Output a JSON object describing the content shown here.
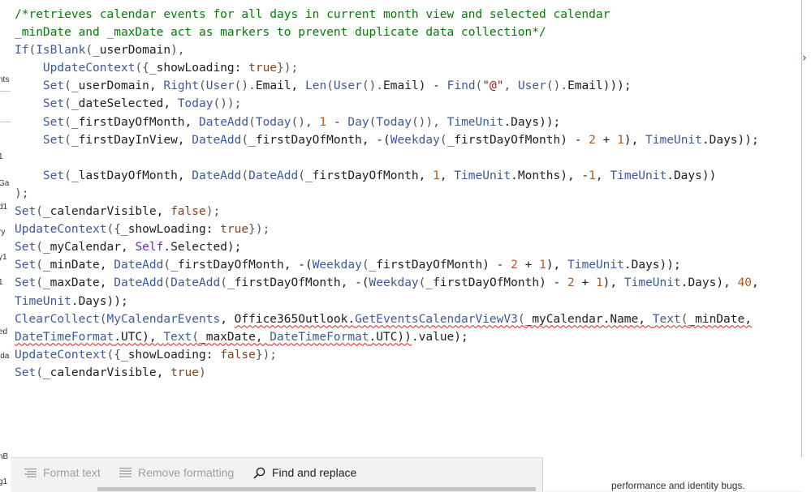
{
  "left_labels": [
    "nts",
    "1",
    "Ga",
    "d1",
    "ry",
    "y1",
    "1",
    "ed",
    "ida",
    "nB",
    "g1"
  ],
  "code_lines": [
    [
      [
        "c",
        "/*retrieves calendar events for all days in current month view and selected calendar"
      ]
    ],
    [
      [
        "c",
        "_minDate and _maxDate act as markers to prevent duplicate data collection*/"
      ]
    ],
    [
      [
        "f",
        "If"
      ],
      [
        "o",
        "("
      ],
      [
        "f",
        "IsBlank"
      ],
      [
        "o",
        "("
      ],
      [
        "v",
        "_userDomain"
      ],
      [
        "o",
        "),"
      ]
    ],
    [
      [
        "v",
        "    "
      ],
      [
        "f",
        "UpdateContext"
      ],
      [
        "o",
        "({"
      ],
      [
        "v",
        "_showLoading: "
      ],
      [
        "k",
        "true"
      ],
      [
        "o",
        "});"
      ]
    ],
    [
      [
        "v",
        "    "
      ],
      [
        "f",
        "Set"
      ],
      [
        "o",
        "("
      ],
      [
        "v",
        "_userDomain, "
      ],
      [
        "f",
        "Right"
      ],
      [
        "o",
        "("
      ],
      [
        "f",
        "User"
      ],
      [
        "o",
        "()."
      ],
      [
        "v",
        "Email, "
      ],
      [
        "f",
        "Len"
      ],
      [
        "o",
        "("
      ],
      [
        "f",
        "User"
      ],
      [
        "o",
        "()."
      ],
      [
        "v",
        "Email) - "
      ],
      [
        "f",
        "Find"
      ],
      [
        "o",
        "("
      ],
      [
        "s",
        "\"@\""
      ],
      [
        "o",
        ", "
      ],
      [
        "f",
        "User"
      ],
      [
        "o",
        "()."
      ],
      [
        "v",
        "Email)));"
      ]
    ],
    [
      [
        "v",
        "    "
      ],
      [
        "f",
        "Set"
      ],
      [
        "o",
        "("
      ],
      [
        "v",
        "_dateSelected, "
      ],
      [
        "f",
        "Today"
      ],
      [
        "o",
        "());"
      ]
    ],
    [
      [
        "v",
        "    "
      ],
      [
        "f",
        "Set"
      ],
      [
        "o",
        "("
      ],
      [
        "v",
        "_firstDayOfMonth, "
      ],
      [
        "f",
        "DateAdd"
      ],
      [
        "o",
        "("
      ],
      [
        "f",
        "Today"
      ],
      [
        "o",
        "(), "
      ],
      [
        "n",
        "1"
      ],
      [
        "v",
        " - "
      ],
      [
        "f",
        "Day"
      ],
      [
        "o",
        "("
      ],
      [
        "f",
        "Today"
      ],
      [
        "o",
        "()), "
      ],
      [
        "f",
        "TimeUnit"
      ],
      [
        "v",
        ".Days));"
      ]
    ],
    [
      [
        "v",
        "    "
      ],
      [
        "f",
        "Set"
      ],
      [
        "o",
        "("
      ],
      [
        "v",
        "_firstDayInView, "
      ],
      [
        "f",
        "DateAdd"
      ],
      [
        "o",
        "("
      ],
      [
        "v",
        "_firstDayOfMonth, -("
      ],
      [
        "f",
        "Weekday"
      ],
      [
        "o",
        "("
      ],
      [
        "v",
        "_firstDayOfMonth) - "
      ],
      [
        "n",
        "2"
      ],
      [
        "v",
        " + "
      ],
      [
        "n",
        "1"
      ],
      [
        "v",
        "), "
      ],
      [
        "f",
        "TimeUnit"
      ],
      [
        "v",
        ".Days));"
      ]
    ],
    [
      [
        "v",
        ""
      ]
    ],
    [
      [
        "v",
        "    "
      ],
      [
        "f",
        "Set"
      ],
      [
        "o",
        "("
      ],
      [
        "v",
        "_lastDayOfMonth, "
      ],
      [
        "f",
        "DateAdd"
      ],
      [
        "o",
        "("
      ],
      [
        "f",
        "DateAdd"
      ],
      [
        "o",
        "("
      ],
      [
        "v",
        "_firstDayOfMonth, "
      ],
      [
        "n",
        "1"
      ],
      [
        "v",
        ", "
      ],
      [
        "f",
        "TimeUnit"
      ],
      [
        "v",
        ".Months), -"
      ],
      [
        "n",
        "1"
      ],
      [
        "v",
        ", "
      ],
      [
        "f",
        "TimeUnit"
      ],
      [
        "v",
        ".Days))"
      ]
    ],
    [
      [
        "o",
        ");"
      ]
    ],
    [
      [
        "f",
        "Set"
      ],
      [
        "o",
        "("
      ],
      [
        "v",
        "_calendarVisible, "
      ],
      [
        "k",
        "false"
      ],
      [
        "o",
        ");"
      ]
    ],
    [
      [
        "f",
        "UpdateContext"
      ],
      [
        "o",
        "({"
      ],
      [
        "v",
        "_showLoading: "
      ],
      [
        "k",
        "true"
      ],
      [
        "o",
        "});"
      ]
    ],
    [
      [
        "f",
        "Set"
      ],
      [
        "o",
        "("
      ],
      [
        "v",
        "_myCalendar, "
      ],
      [
        "p",
        "Self"
      ],
      [
        "v",
        ".Selected);"
      ]
    ],
    [
      [
        "f",
        "Set"
      ],
      [
        "o",
        "("
      ],
      [
        "v",
        "_minDate, "
      ],
      [
        "f",
        "DateAdd"
      ],
      [
        "o",
        "("
      ],
      [
        "v",
        "_firstDayOfMonth, -("
      ],
      [
        "f",
        "Weekday"
      ],
      [
        "o",
        "("
      ],
      [
        "v",
        "_firstDayOfMonth) - "
      ],
      [
        "n",
        "2"
      ],
      [
        "v",
        " + "
      ],
      [
        "n",
        "1"
      ],
      [
        "v",
        "), "
      ],
      [
        "f",
        "TimeUnit"
      ],
      [
        "v",
        ".Days));"
      ]
    ],
    [
      [
        "f",
        "Set"
      ],
      [
        "o",
        "("
      ],
      [
        "v",
        "_maxDate, "
      ],
      [
        "f",
        "DateAdd"
      ],
      [
        "o",
        "("
      ],
      [
        "f",
        "DateAdd"
      ],
      [
        "o",
        "("
      ],
      [
        "v",
        "_firstDayOfMonth, -("
      ],
      [
        "f",
        "Weekday"
      ],
      [
        "o",
        "("
      ],
      [
        "v",
        "_firstDayOfMonth) - "
      ],
      [
        "n",
        "2"
      ],
      [
        "v",
        " + "
      ],
      [
        "n",
        "1"
      ],
      [
        "v",
        "), "
      ],
      [
        "f",
        "TimeUnit"
      ],
      [
        "v",
        ".Days), "
      ],
      [
        "n",
        "40"
      ],
      [
        "v",
        ","
      ]
    ],
    [
      [
        "f",
        "TimeUnit"
      ],
      [
        "v",
        ".Days));"
      ]
    ],
    [
      [
        "f",
        "ClearCollect"
      ],
      [
        "o",
        "("
      ],
      [
        "f",
        "MyCalendarEvents"
      ],
      [
        "v",
        ", "
      ],
      [
        "vs",
        "Office365Outlook."
      ],
      [
        "fs",
        "GetEventsCalendarViewV3"
      ],
      [
        "os",
        "("
      ],
      [
        "vs",
        "_myCalendar.Name, "
      ],
      [
        "fs",
        "Text"
      ],
      [
        "os",
        "("
      ],
      [
        "vs",
        "_minDate,"
      ]
    ],
    [
      [
        "fs",
        "DateTimeFormat"
      ],
      [
        "vs",
        ".UTC), "
      ],
      [
        "fs",
        "Text"
      ],
      [
        "os",
        "("
      ],
      [
        "vs",
        "_maxDate, "
      ],
      [
        "fs",
        "DateTimeFormat"
      ],
      [
        "vs",
        ".UTC))"
      ],
      [
        "v",
        ".value);"
      ]
    ],
    [
      [
        "f",
        "UpdateContext"
      ],
      [
        "o",
        "({"
      ],
      [
        "v",
        "_showLoading: "
      ],
      [
        "k",
        "false"
      ],
      [
        "o",
        "});"
      ]
    ],
    [
      [
        "f",
        "Set"
      ],
      [
        "o",
        "("
      ],
      [
        "v",
        "_calendarVisible, "
      ],
      [
        "k",
        "true"
      ],
      [
        "o",
        ")"
      ]
    ]
  ],
  "toolbar": {
    "format_text": "Format text",
    "remove_formatting": "Remove formatting",
    "find_replace": "Find and replace"
  },
  "bottom_right_text": "performance and identity bugs."
}
